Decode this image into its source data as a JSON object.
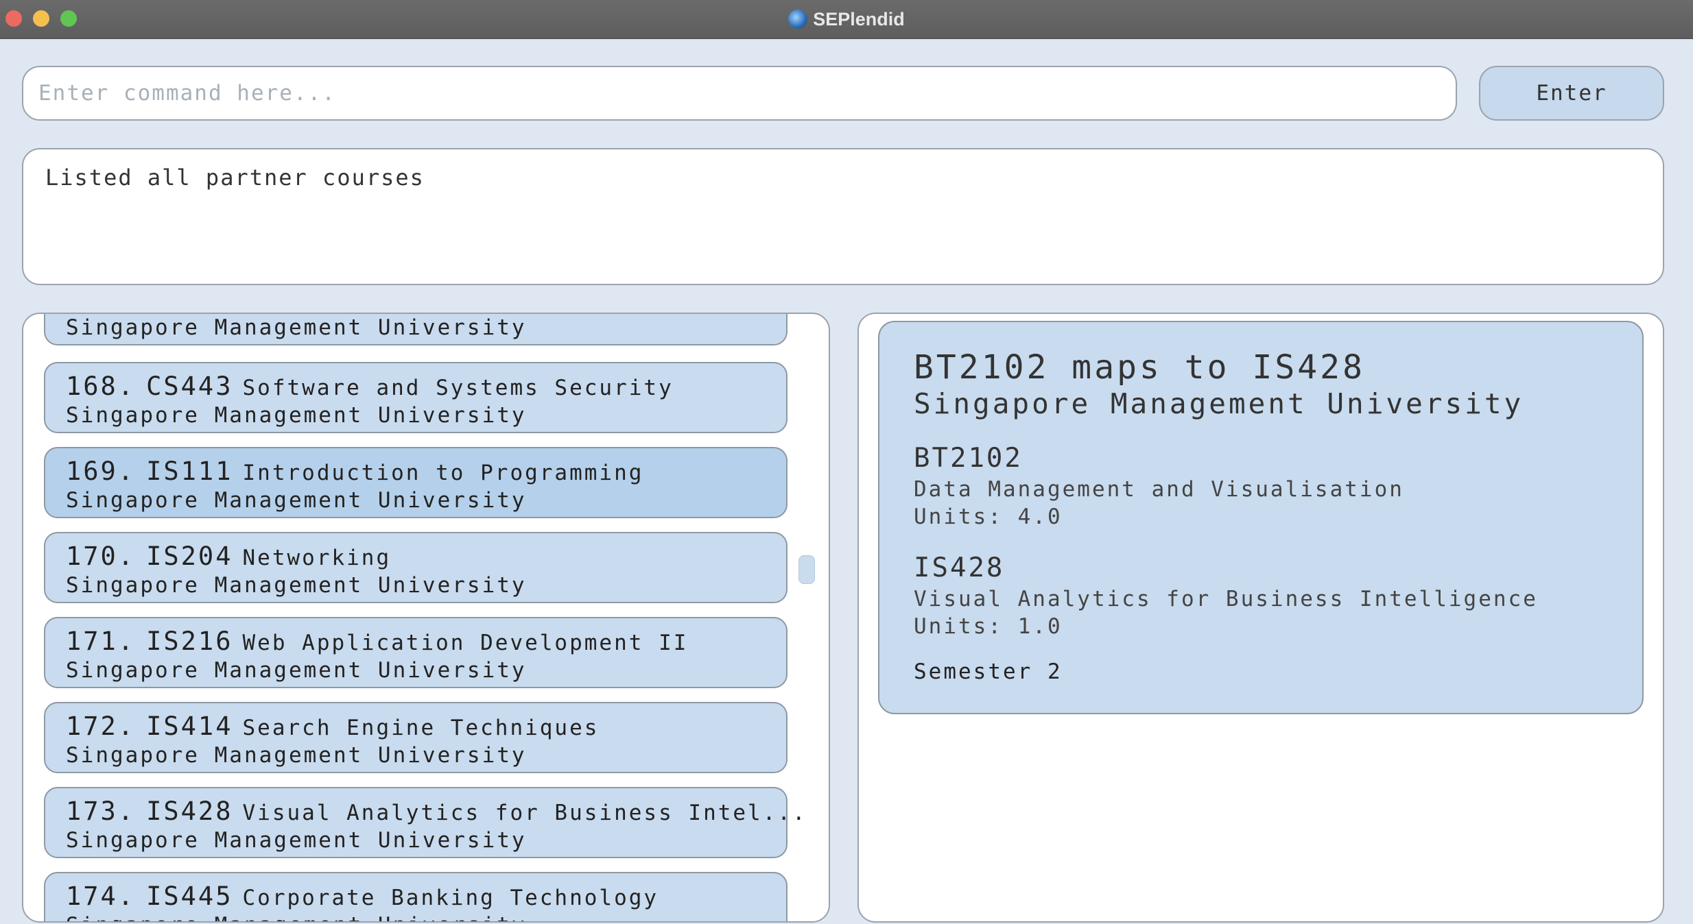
{
  "window": {
    "title": "SEPlendid"
  },
  "command": {
    "placeholder": "Enter command here...",
    "value": "",
    "enter_label": "Enter"
  },
  "result": {
    "text": "Listed all partner courses"
  },
  "list": {
    "partial_top_university": "Singapore Management University",
    "items": [
      {
        "index": "168.",
        "code": "CS443",
        "name": "Software and Systems Security",
        "university": "Singapore Management University",
        "selected": false
      },
      {
        "index": "169.",
        "code": "IS111",
        "name": "Introduction to Programming",
        "university": "Singapore Management University",
        "selected": true
      },
      {
        "index": "170.",
        "code": "IS204",
        "name": "Networking",
        "university": "Singapore Management University",
        "selected": false
      },
      {
        "index": "171.",
        "code": "IS216",
        "name": "Web Application Development II",
        "university": "Singapore Management University",
        "selected": false
      },
      {
        "index": "172.",
        "code": "IS414",
        "name": "Search Engine Techniques",
        "university": "Singapore Management University",
        "selected": false
      },
      {
        "index": "173.",
        "code": "IS428",
        "name": "Visual Analytics for Business Intel...",
        "university": "Singapore Management University",
        "selected": false
      },
      {
        "index": "174.",
        "code": "IS445",
        "name": "Corporate Banking Technology",
        "university": "Singapore Management University",
        "selected": false
      }
    ]
  },
  "detail": {
    "heading": "BT2102 maps to IS428",
    "university": "Singapore Management University",
    "local": {
      "code": "BT2102",
      "name": "Data Management and Visualisation",
      "units": "Units: 4.0"
    },
    "partner": {
      "code": "IS428",
      "name": "Visual Analytics for Business Intelligence",
      "units": "Units: 1.0"
    },
    "semester": "Semester 2"
  },
  "colors": {
    "background": "#dfe8f2",
    "card": "#c9dbee",
    "card_selected": "#b5d0ea",
    "titlebar": "#626262"
  }
}
